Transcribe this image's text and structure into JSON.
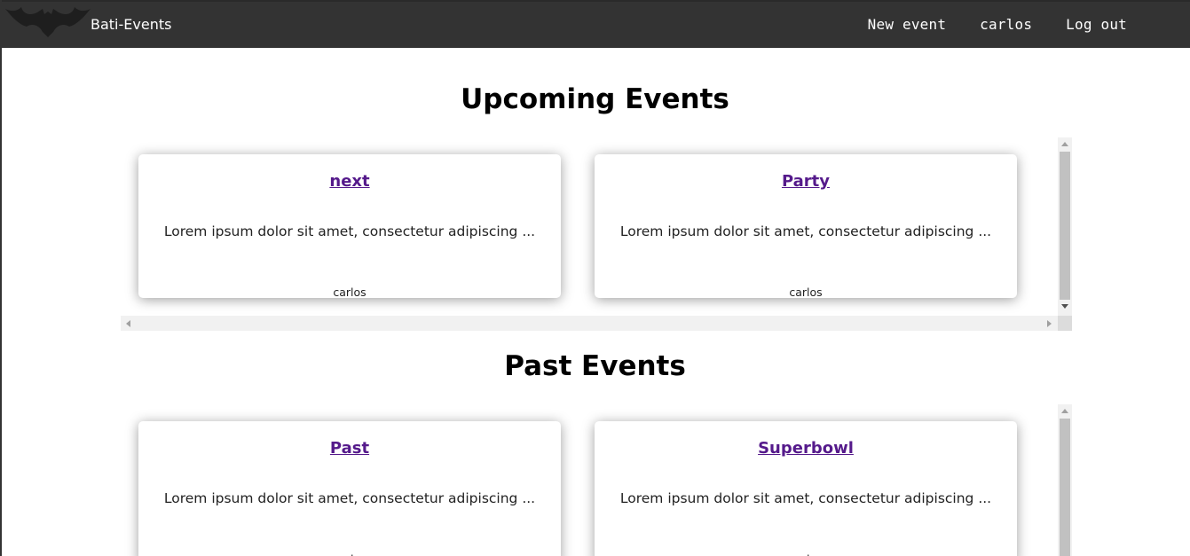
{
  "navbar": {
    "brand": "Bati-Events",
    "links": [
      "New event",
      "carlos",
      "Log out"
    ],
    "logo_icon": "bat-logo-icon"
  },
  "upcoming": {
    "title": "Upcoming Events",
    "events": [
      {
        "title": "next",
        "description": "Lorem ipsum dolor sit amet, consectetur adipiscing ...",
        "author": "carlos"
      },
      {
        "title": "Party",
        "description": "Lorem ipsum dolor sit amet, consectetur adipiscing ...",
        "author": "carlos"
      }
    ]
  },
  "past": {
    "title": "Past Events",
    "events": [
      {
        "title": "Past",
        "description": "Lorem ipsum dolor sit amet, consectetur adipiscing ...",
        "author": "carlos"
      },
      {
        "title": "Superbowl",
        "description": "Lorem ipsum dolor sit amet, consectetur adipiscing ...",
        "author": "carlos"
      }
    ]
  },
  "colors": {
    "navbar_bg": "#333333",
    "link_visited": "#551a8b"
  }
}
